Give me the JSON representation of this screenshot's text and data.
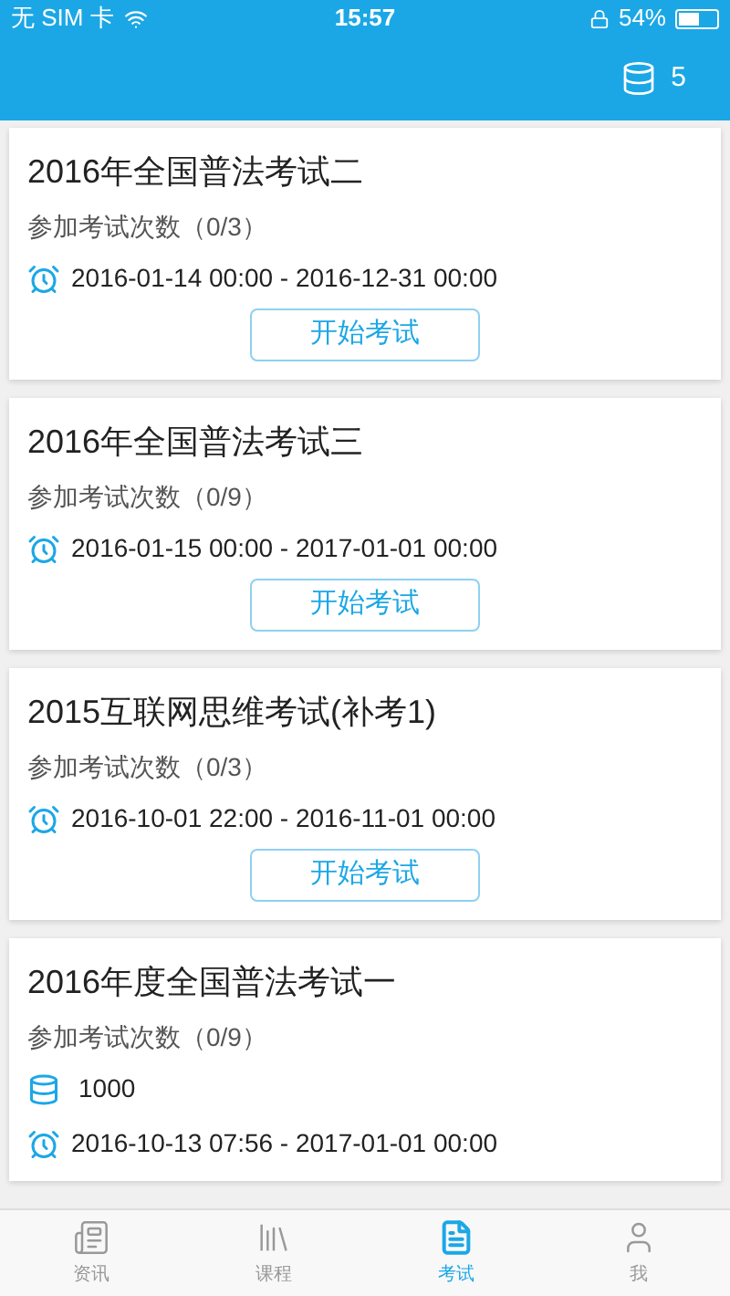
{
  "status_bar": {
    "carrier": "无 SIM 卡",
    "time": "15:57",
    "battery": "54%"
  },
  "header": {
    "coins": "5"
  },
  "exams": [
    {
      "title": "2016年全国普法考试二",
      "attempts": "参加考试次数（0/3）",
      "period": "2016-01-14 00:00 - 2016-12-31 00:00",
      "button": "开始考试"
    },
    {
      "title": "2016年全国普法考试三",
      "attempts": "参加考试次数（0/9）",
      "period": "2016-01-15 00:00 - 2017-01-01 00:00",
      "button": "开始考试"
    },
    {
      "title": "2015互联网思维考试(补考1)",
      "attempts": "参加考试次数（0/3）",
      "period": "2016-10-01 22:00 - 2016-11-01 00:00",
      "button": "开始考试"
    },
    {
      "title": "2016年度全国普法考试一",
      "attempts": "参加考试次数（0/9）",
      "coins": "1000",
      "period": "2016-10-13 07:56 - 2017-01-01 00:00"
    }
  ],
  "tabs": [
    {
      "kind": "news",
      "label": "资讯",
      "selected": false
    },
    {
      "kind": "courses",
      "label": "课程",
      "selected": false
    },
    {
      "kind": "exams",
      "label": "考试",
      "selected": true
    },
    {
      "kind": "me",
      "label": "我",
      "selected": false
    }
  ]
}
